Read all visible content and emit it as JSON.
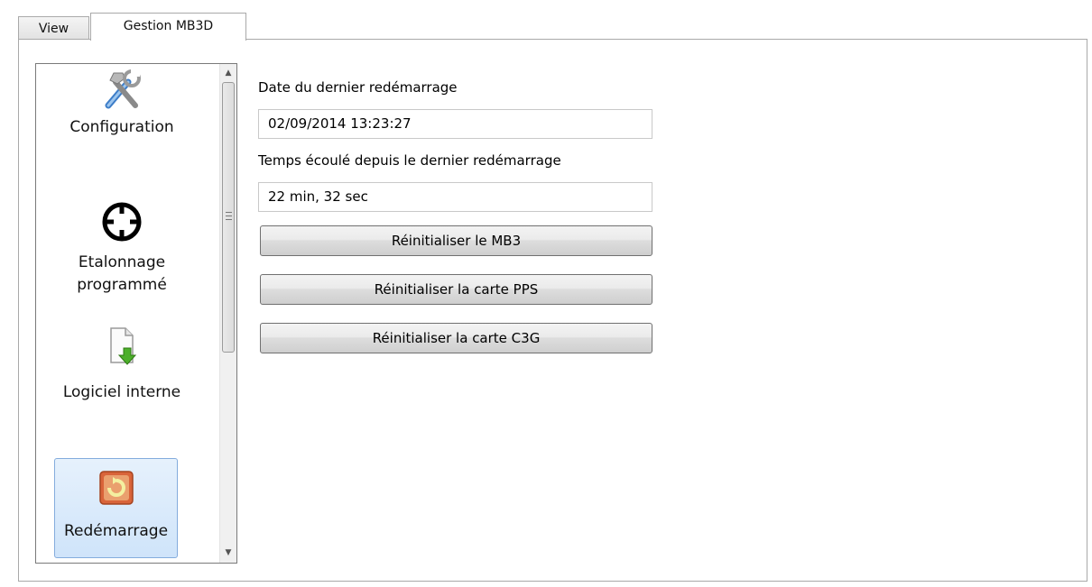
{
  "tabs": [
    {
      "label": "View",
      "active": false
    },
    {
      "label": "Gestion MB3D",
      "active": true
    }
  ],
  "sidebar": {
    "items": [
      {
        "label": "Configuration",
        "icon": "tools-icon"
      },
      {
        "label": "Etalonnage programmé",
        "icon": "crosshair-icon"
      },
      {
        "label": "Logiciel interne",
        "icon": "document-download-icon"
      },
      {
        "label": "Redémarrage",
        "icon": "restart-icon",
        "selected": true
      }
    ]
  },
  "main": {
    "date_label": "Date du dernier redémarrage",
    "date_value": "02/09/2014 13:23:27",
    "elapsed_label": "Temps écoulé depuis le dernier redémarrage",
    "elapsed_value": "22 min, 32 sec",
    "buttons": {
      "reset_mb3": "Réinitialiser le MB3",
      "reset_pps": "Réinitialiser la carte PPS",
      "reset_c3g": "Réinitialiser la carte C3G"
    }
  },
  "colors": {
    "selection_bg": "#cfe4fa",
    "selection_border": "#84acdd"
  }
}
